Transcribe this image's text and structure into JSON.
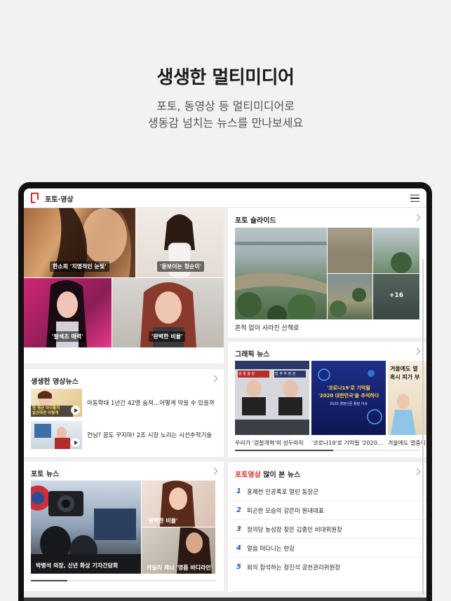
{
  "hero": {
    "title": "생생한 멀티미디어",
    "subtitle_line1": "포토, 동영상 등 멀티미디어로",
    "subtitle_line2": "생동감 넘치는 뉴스를 만나보세요"
  },
  "topbar": {
    "section": "포토·영상"
  },
  "featured": {
    "captions": [
      "한소희 '치명적인 눈빛'",
      "'돋보이는 청순미'",
      "'팔색조 매력'",
      "'완벽한 비율'"
    ]
  },
  "video_news": {
    "title": "생생한 영상뉴스",
    "items": [
      {
        "title": "아동학대 1년간 42명 숨져…어떻게 막을 수 있을까"
      },
      {
        "title": "컨닝? 꿈도 꾸지마! 2조 시장 노리는 시선추적기술"
      }
    ],
    "thumb_text": "형 평균 아이돌의\n발견하면 이렇게"
  },
  "photo_news": {
    "title": "포토 뉴스",
    "main_caption": "박병석 의장, 신년 화상 기자간담회",
    "side_captions": [
      "'완벽한 비율'",
      "카일리 제너 '명품 바디라인'"
    ]
  },
  "photo_slide": {
    "title": "포토 슬라이드",
    "caption": "흔적 없이 사라진 산책로",
    "more_count": "+16"
  },
  "graphic_news": {
    "title": "그래픽 뉴스",
    "items": [
      {
        "caption": "우리가 '검찰개혁'의 성두마차",
        "label1": "검 찰 총 장",
        "label2": "법 무 부 장 관"
      },
      {
        "caption": "'코로나19'로 기억될 '2020…",
        "headline1": "'코로나19'로 기억될",
        "headline2": "'2020 대한민국'을 추억하다",
        "sub": "2020 경향신문 돌발 이슈"
      },
      {
        "caption": "겨울에도 열중이",
        "headline1": "겨울에도 열",
        "headline2": "혹시 피가 부"
      }
    ]
  },
  "most_viewed": {
    "title_red": "포토영상",
    "title_rest": " 많이 본 뉴스",
    "items": [
      {
        "rank": "1",
        "title": "홍제천 인공폭포 얼린 동장군"
      },
      {
        "rank": "2",
        "title": "피곤한 모습의 강은미 원내대표"
      },
      {
        "rank": "3",
        "title": "정의당 농성장 찾은 김종인 비대위원장"
      },
      {
        "rank": "4",
        "title": "얼음 떠다니는 한강"
      },
      {
        "rank": "5",
        "title": "회의 참석하는 정진석 공천관리위원장"
      }
    ]
  },
  "colors": {
    "accent_red": "#d8282c",
    "rank_blue": "#1f5bb5"
  }
}
